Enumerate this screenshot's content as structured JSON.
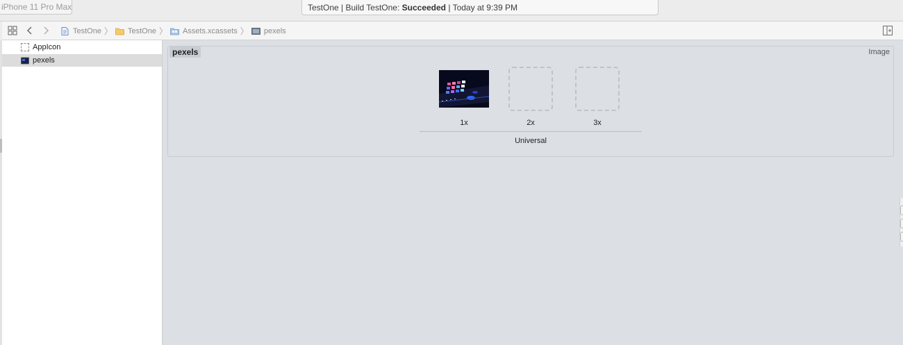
{
  "toolbar": {
    "scheme_device": "iPhone 11 Pro Max",
    "activity_prefix": "TestOne | Build TestOne: ",
    "activity_status": "Succeeded",
    "activity_suffix": " | Today at 9:39 PM"
  },
  "jumpbar": {
    "crumbs": [
      {
        "label": "TestOne",
        "icon": "project-file-icon"
      },
      {
        "label": "TestOne",
        "icon": "folder-icon"
      },
      {
        "label": "Assets.xcassets",
        "icon": "asset-catalog-icon"
      },
      {
        "label": "pexels",
        "icon": "image-set-icon"
      }
    ]
  },
  "outline": {
    "items": [
      {
        "label": "AppIcon",
        "icon": "app-icon-set-icon",
        "selected": false
      },
      {
        "label": "pexels",
        "icon": "image-set-icon",
        "selected": true
      }
    ]
  },
  "image_set": {
    "name": "pexels",
    "type": "Image",
    "slots": [
      {
        "label": "1x",
        "filled": true
      },
      {
        "label": "2x",
        "filled": false
      },
      {
        "label": "3x",
        "filled": false
      }
    ],
    "idiom": "Universal"
  },
  "colors": {
    "editor_bg": "#dcdfe3",
    "selection": "#dcdcdc",
    "folder": "#f6c96b",
    "catalog": "#8fb3d9"
  }
}
